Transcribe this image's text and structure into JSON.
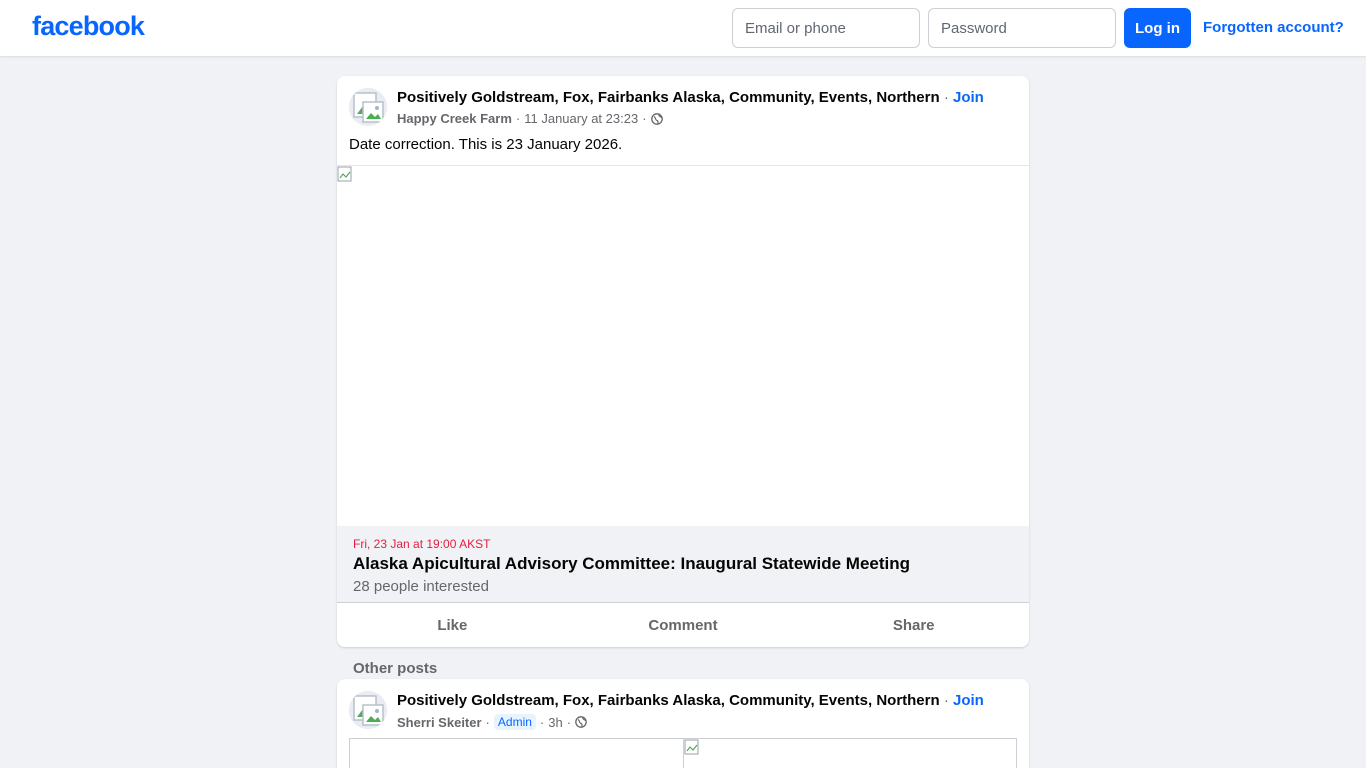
{
  "header": {
    "logo_text": "facebook",
    "email_placeholder": "Email or phone",
    "password_placeholder": "Password",
    "login_label": "Log in",
    "forgot_label": "Forgotten account?"
  },
  "post": {
    "group_name": "Positively Goldstream, Fox, Fairbanks Alaska, Community, Events, Northern",
    "join_label": "Join",
    "separator": "·",
    "author": "Happy Creek Farm",
    "timestamp": "11 January at 23:23",
    "privacy_icon": "globe-icon",
    "text": "Date correction. This is 23 January 2026.",
    "event": {
      "date": "Fri, 23 Jan at 19:00 AKST",
      "title": "Alaska Apicultural Advisory Committee: Inaugural Statewide Meeting",
      "interest": "28 people interested"
    },
    "actions": [
      "Like",
      "Comment",
      "Share"
    ]
  },
  "other_posts_label": "Other posts",
  "second_post": {
    "group_name": "Positively Goldstream, Fox, Fairbanks Alaska, Community, Events, Northern",
    "join_label": "Join",
    "author": "Sherri Skeiter",
    "badge": "Admin",
    "timestamp": "3h",
    "privacy_icon": "globe-icon"
  },
  "colors": {
    "brand": "#0866ff",
    "background": "#f0f2f5",
    "event_date": "#e41e3f",
    "secondary_text": "#65676b"
  }
}
